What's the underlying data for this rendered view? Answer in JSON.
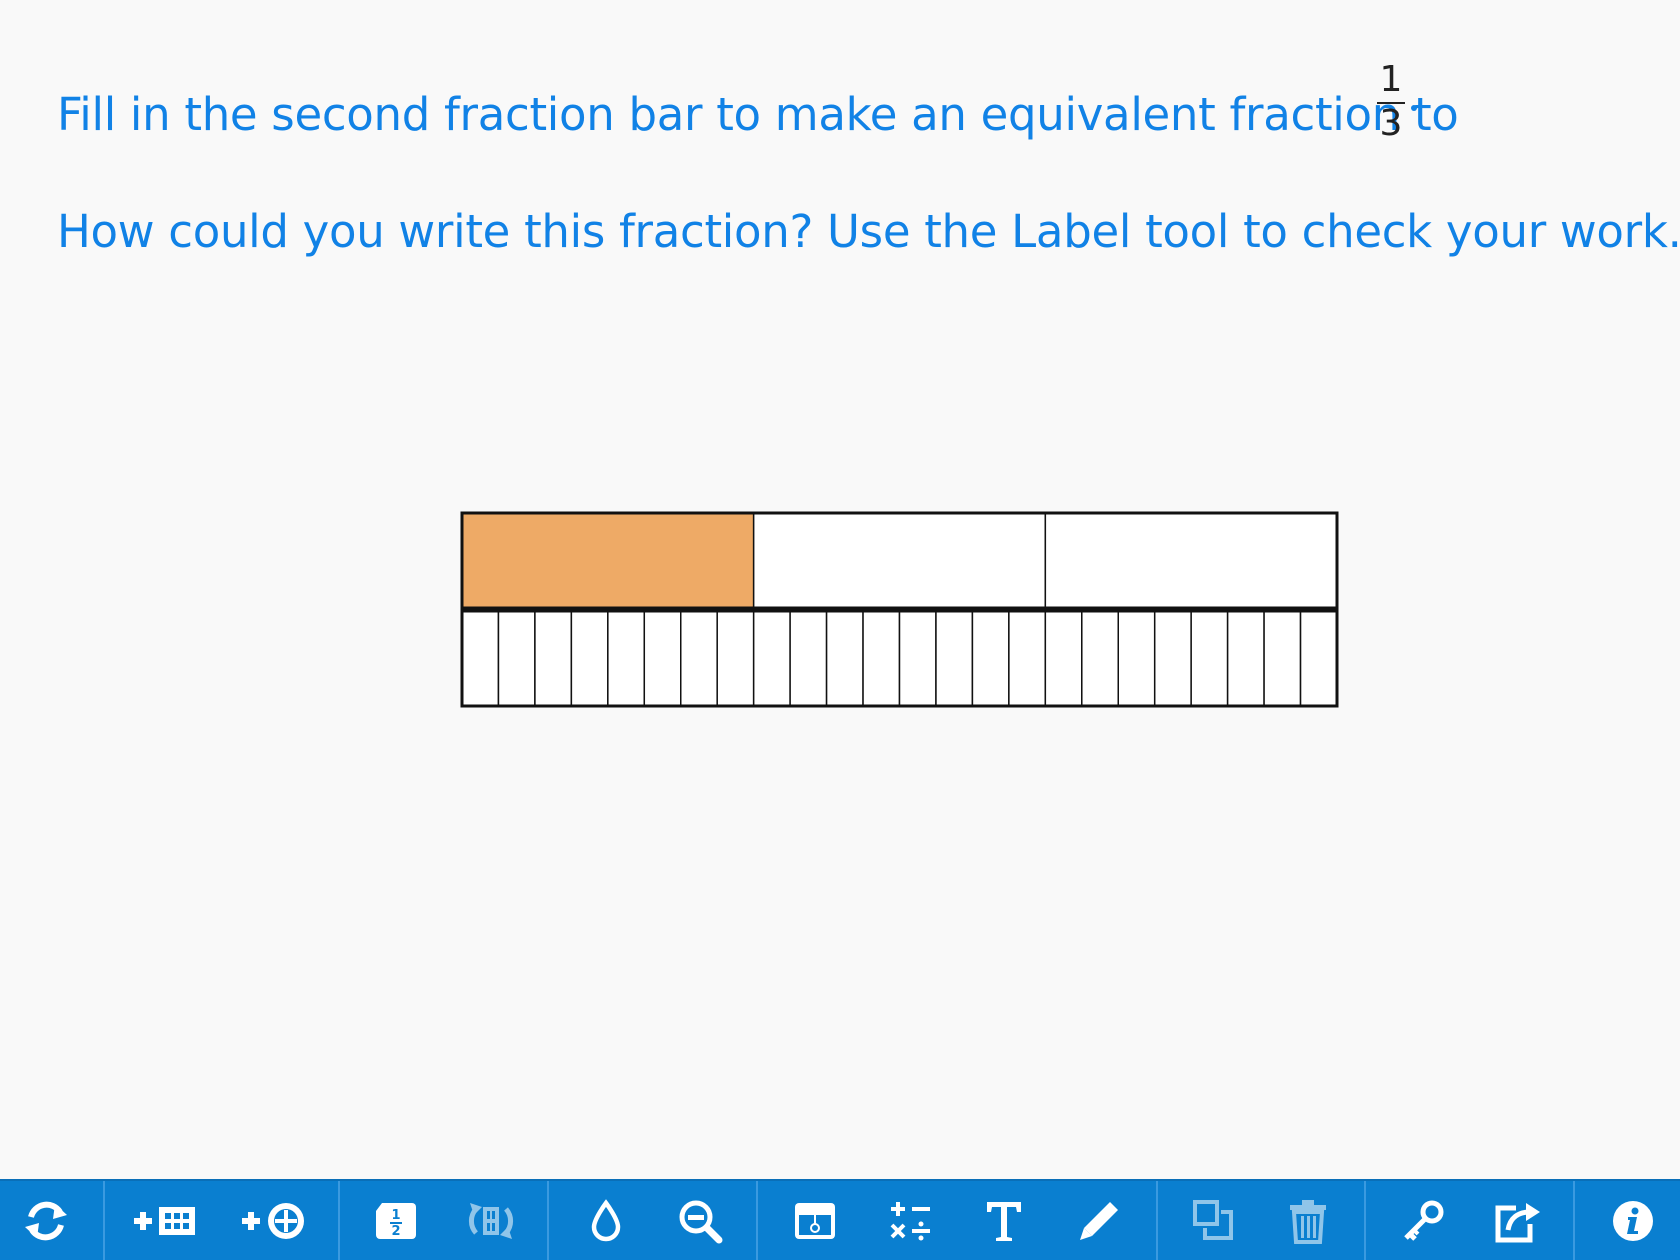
{
  "prompt": {
    "line1": "Fill in the second fraction bar to make an equivalent fraction to",
    "fraction": {
      "numerator": "1",
      "denominator": "3"
    },
    "line2": "How could you write this fraction? Use the Label tool to check your work."
  },
  "fraction_bars": [
    {
      "parts": 3,
      "shaded_parts": [
        0
      ],
      "shade_color": "#eeaa66"
    },
    {
      "parts": 24,
      "shaded_parts": [],
      "shade_color": "#eeaa66"
    }
  ],
  "colors": {
    "text": "#1182e6",
    "toolbar": "#0a7fd0",
    "background": "#f9f9f9"
  },
  "toolbar": {
    "tools": [
      {
        "icon": "refresh-icon",
        "enabled": true
      },
      {
        "icon": "add-fraction-bar-icon",
        "enabled": true
      },
      {
        "icon": "add-fraction-circle-icon",
        "enabled": true
      },
      {
        "icon": "fraction-label-icon",
        "enabled": true
      },
      {
        "icon": "rotate-bar-icon",
        "enabled": false
      },
      {
        "icon": "fill-color-icon",
        "enabled": true
      },
      {
        "icon": "zoom-out-icon",
        "enabled": true
      },
      {
        "icon": "shade-icon",
        "enabled": true
      },
      {
        "icon": "operations-icon",
        "enabled": true
      },
      {
        "icon": "text-icon",
        "enabled": true
      },
      {
        "icon": "pencil-icon",
        "enabled": true
      },
      {
        "icon": "duplicate-icon",
        "enabled": false
      },
      {
        "icon": "trash-icon",
        "enabled": false
      },
      {
        "icon": "key-icon",
        "enabled": true
      },
      {
        "icon": "share-icon",
        "enabled": true
      },
      {
        "icon": "info-icon",
        "enabled": true
      }
    ]
  }
}
